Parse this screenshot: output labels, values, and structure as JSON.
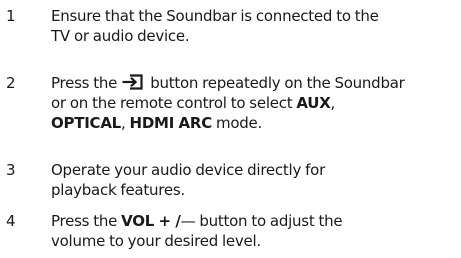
{
  "steps": [
    {
      "number": "1",
      "text_line1": "Ensure that the Soundbar is connected to the",
      "text_line2": "TV or audio device."
    },
    {
      "number": "2",
      "text_line1_before_icon": "Press the",
      "icon": "source-input-icon",
      "text_line1_after_icon": "button repeatedly on the Soundbar",
      "text_line2": "or on the remote control to select",
      "mode_aux": "AUX",
      "comma": ",",
      "mode_optical": "OPTICAL",
      "mode_hdmi_arc": "HDMI ARC",
      "text_line3_end": "mode."
    },
    {
      "number": "3",
      "text_line1": "Operate your audio device directly for",
      "text_line2": "playback features."
    },
    {
      "number": "4",
      "text_line1_before": "Press the",
      "button_label": "VOL + /",
      "minus_symbol": "—",
      "text_line1_after": "button to adjust the",
      "text_line2": "volume to your desired level."
    }
  ]
}
